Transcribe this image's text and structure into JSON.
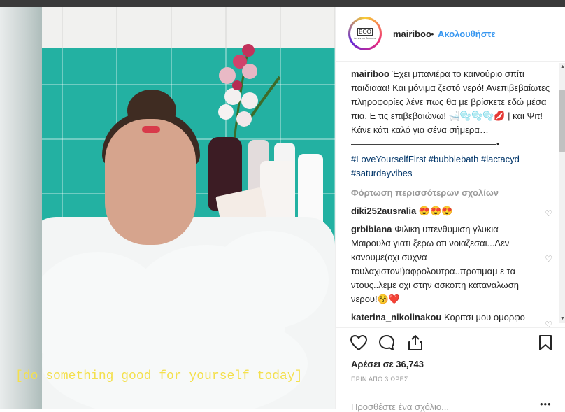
{
  "post": {
    "overlay_text": "[do something good for yourself today]"
  },
  "header": {
    "avatar_logo": "BOO",
    "avatar_sub": "Je vis en Bonheur",
    "username": "mairiboo",
    "dot": "•",
    "follow_label": "Ακολουθήστε"
  },
  "caption": {
    "username": "mairiboo",
    "text": "Έχει μπανιέρα το καινούριο σπίτι παιδιααα! Και μόνιμα ζεστό νερό! Ανεπιβεβαίωτες πληροφορίες λένε πως θα με βρίσκετε εδώ μέσα πια. Ε τις επιβεβαιώνω! 🛁🫧🫧🫧💋 | και Ψιτ! Κάνε κάτι καλό για σένα σήμερα… ————————————————•",
    "hashtags": "#LoveYourselfFirst #bubblebath #lactacyd #saturdayvibes"
  },
  "load_more_label": "Φόρτωση περισσότερων σχολίων",
  "comments": [
    {
      "user": "diki252ausralia",
      "text": "😍😍😍"
    },
    {
      "user": "grbibiana",
      "text": "Φιλικη υπενθυμιση γλυκια Μαιρουλα γιατι ξερω οτι νοιαζεσαι...Δεν κανουμε(οχι συχνα τουλαχιστον!)αφρολουτρα..προτιμαμ ε τα ντους..λεμε οχι στην ασκοπη καταναλωση νερου!😚❤️"
    },
    {
      "user": "katerina_nikolinakou",
      "text": "Κοριτσι μου ομορφο❤️"
    }
  ],
  "likes_label": "Αρέσει σε 36,743",
  "time_label": "ΠΡΙΝ ΑΠΟ 3 ΩΡΕΣ",
  "add_comment_placeholder": "Προσθέστε ένα σχόλιο...",
  "more_options": "•••",
  "colors": {
    "link": "#3897f0",
    "hashtag": "#003569",
    "overlay_text": "#f4e04d"
  }
}
